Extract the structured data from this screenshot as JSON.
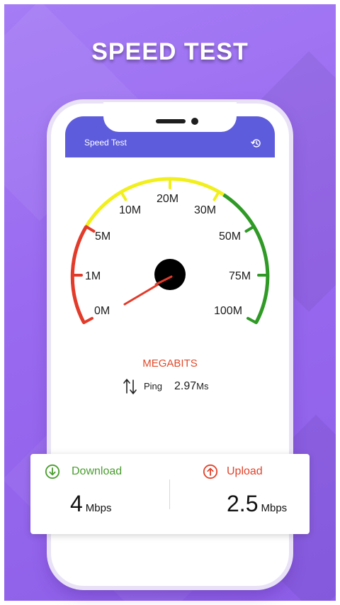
{
  "headline": "SPEED TEST",
  "appbar": {
    "title": "Speed Test",
    "history_icon": "history-icon"
  },
  "gauge": {
    "labels": [
      "0M",
      "1M",
      "5M",
      "10M",
      "20M",
      "30M",
      "50M",
      "75M",
      "100M"
    ],
    "colors": {
      "low": "#e23b2a",
      "mid": "#f1ef1c",
      "high": "#2f9a25",
      "needle": "#e23b2a",
      "hub": "#000000"
    }
  },
  "unit_label": "MEGABITS",
  "ping": {
    "label": "Ping",
    "value": "2.97",
    "unit": "Ms"
  },
  "results": {
    "download": {
      "label": "Download",
      "value": "4",
      "unit": "Mbps",
      "color": "#4a9d2f"
    },
    "upload": {
      "label": "Upload",
      "value": "2.5",
      "unit": "Mbps",
      "color": "#e0442c"
    }
  }
}
